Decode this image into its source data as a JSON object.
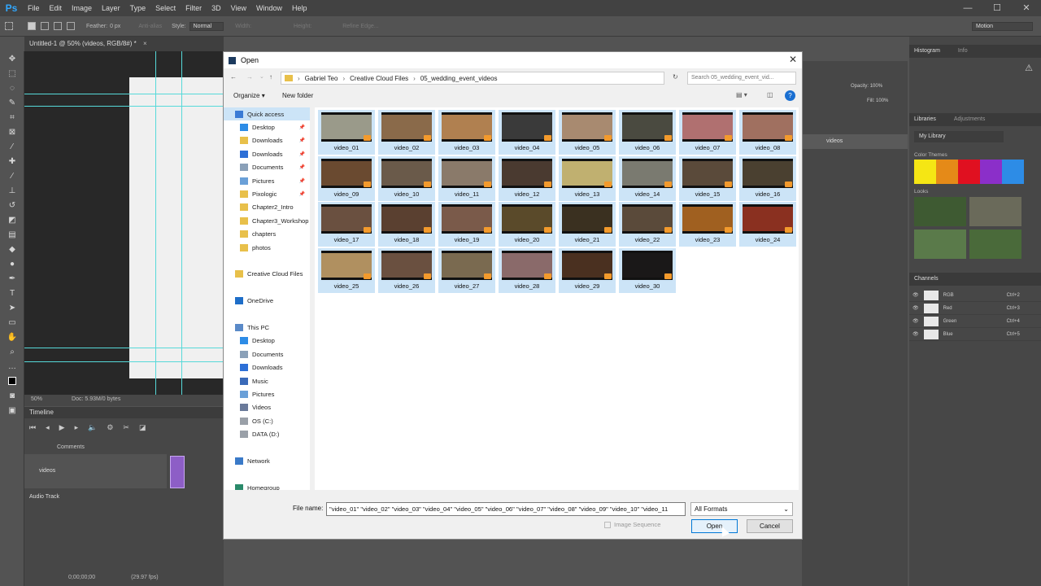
{
  "app": {
    "logo": "Ps",
    "menu": [
      "File",
      "Edit",
      "Image",
      "Layer",
      "Type",
      "Select",
      "Filter",
      "3D",
      "View",
      "Window",
      "Help"
    ]
  },
  "options_bar": {
    "feather_label": "Feather:",
    "feather_value": "0 px",
    "antialias": "Anti-alias",
    "style_label": "Style:",
    "style_value": "Normal",
    "width_label": "Width:",
    "height_label": "Height:",
    "refine": "Refine Edge...",
    "workspace": "Motion"
  },
  "document": {
    "tab_title": "Untitled-1 @ 50% (videos, RGB/8#) *",
    "zoom": "50%",
    "doc_info": "Doc: 5.93M/0 bytes"
  },
  "timeline": {
    "title": "Timeline",
    "comments": "Comments",
    "video_track": "videos",
    "audio_track": "Audio Track",
    "timecode": "0;00;00;00",
    "fps": "(29.97 fps)"
  },
  "right_panels": {
    "histogram_tab": "Histogram",
    "info_tab": "Info",
    "libraries_tab": "Libraries",
    "adjustments_tab": "Adjustments",
    "library_select": "My Library",
    "color_themes": "Color Themes",
    "looks": "Looks",
    "channels_tab": "Channels",
    "opacity_label": "Opacity:",
    "opacity_value": "100%",
    "fill_label": "Fill:",
    "fill_value": "100%",
    "layer_name": "videos",
    "swatches": [
      "#f5e614",
      "#e58a18",
      "#e01020",
      "#8b2fc9",
      "#2d8ce6"
    ],
    "channels": [
      {
        "name": "RGB",
        "shortcut": "Ctrl+2"
      },
      {
        "name": "Red",
        "shortcut": "Ctrl+3"
      },
      {
        "name": "Green",
        "shortcut": "Ctrl+4"
      },
      {
        "name": "Blue",
        "shortcut": "Ctrl+5"
      }
    ]
  },
  "dialog": {
    "title": "Open",
    "breadcrumb": [
      "Gabriel Teo",
      "Creative Cloud Files",
      "05_wedding_event_videos"
    ],
    "search_placeholder": "Search 05_wedding_event_vid...",
    "organize": "Organize",
    "new_folder": "New folder",
    "nav": [
      {
        "label": "Quick access",
        "icon": "star",
        "indent": 0,
        "selected": true
      },
      {
        "label": "Desktop",
        "icon": "desktop",
        "indent": 1,
        "pin": true
      },
      {
        "label": "Downloads",
        "icon": "folder",
        "indent": 1,
        "pin": true
      },
      {
        "label": "Downloads",
        "icon": "download",
        "indent": 1,
        "pin": true
      },
      {
        "label": "Documents",
        "icon": "documents",
        "indent": 1,
        "pin": true
      },
      {
        "label": "Pictures",
        "icon": "pictures",
        "indent": 1,
        "pin": true
      },
      {
        "label": "Pixologic",
        "icon": "folder",
        "indent": 1,
        "pin": true
      },
      {
        "label": "Chapter2_Intro",
        "icon": "folder",
        "indent": 1
      },
      {
        "label": "Chapter3_Workshop",
        "icon": "folder",
        "indent": 1
      },
      {
        "label": "chapters",
        "icon": "folder",
        "indent": 1
      },
      {
        "label": "photos",
        "icon": "folder",
        "indent": 1
      },
      {
        "label": "",
        "icon": "",
        "indent": 0
      },
      {
        "label": "Creative Cloud Files",
        "icon": "folder",
        "indent": 0
      },
      {
        "label": "",
        "icon": "",
        "indent": 0
      },
      {
        "label": "OneDrive",
        "icon": "cloud",
        "indent": 0
      },
      {
        "label": "",
        "icon": "",
        "indent": 0
      },
      {
        "label": "This PC",
        "icon": "pc",
        "indent": 0
      },
      {
        "label": "Desktop",
        "icon": "desktop",
        "indent": 1
      },
      {
        "label": "Documents",
        "icon": "documents",
        "indent": 1
      },
      {
        "label": "Downloads",
        "icon": "download",
        "indent": 1
      },
      {
        "label": "Music",
        "icon": "music",
        "indent": 1
      },
      {
        "label": "Pictures",
        "icon": "pictures",
        "indent": 1
      },
      {
        "label": "Videos",
        "icon": "videos",
        "indent": 1
      },
      {
        "label": "OS (C:)",
        "icon": "drive",
        "indent": 1
      },
      {
        "label": "DATA (D:)",
        "icon": "drive",
        "indent": 1
      },
      {
        "label": "",
        "icon": "",
        "indent": 0
      },
      {
        "label": "Network",
        "icon": "network",
        "indent": 0
      },
      {
        "label": "",
        "icon": "",
        "indent": 0
      },
      {
        "label": "Homegroup",
        "icon": "homegroup",
        "indent": 0
      }
    ],
    "files": [
      {
        "name": "video_01",
        "tone": "#9a9a8a"
      },
      {
        "name": "video_02",
        "tone": "#8a6a4a"
      },
      {
        "name": "video_03",
        "tone": "#b08050"
      },
      {
        "name": "video_04",
        "tone": "#3a3a3a"
      },
      {
        "name": "video_05",
        "tone": "#a88a70"
      },
      {
        "name": "video_06",
        "tone": "#4a4a40"
      },
      {
        "name": "video_07",
        "tone": "#b07070"
      },
      {
        "name": "video_08",
        "tone": "#a07060"
      },
      {
        "name": "video_09",
        "tone": "#6a4a30"
      },
      {
        "name": "video_10",
        "tone": "#6a5a4a"
      },
      {
        "name": "video_11",
        "tone": "#8a7a6a"
      },
      {
        "name": "video_12",
        "tone": "#4a3a30"
      },
      {
        "name": "video_13",
        "tone": "#c0b070"
      },
      {
        "name": "video_14",
        "tone": "#7a7a70"
      },
      {
        "name": "video_15",
        "tone": "#5a4a3a"
      },
      {
        "name": "video_16",
        "tone": "#4a4030"
      },
      {
        "name": "video_17",
        "tone": "#6a5040"
      },
      {
        "name": "video_18",
        "tone": "#5a4030"
      },
      {
        "name": "video_19",
        "tone": "#7a5a4a"
      },
      {
        "name": "video_20",
        "tone": "#5a4a2a"
      },
      {
        "name": "video_21",
        "tone": "#3a3020"
      },
      {
        "name": "video_22",
        "tone": "#5a4a3a"
      },
      {
        "name": "video_23",
        "tone": "#a06020"
      },
      {
        "name": "video_24",
        "tone": "#8a3020"
      },
      {
        "name": "video_25",
        "tone": "#b09060"
      },
      {
        "name": "video_26",
        "tone": "#6a5040"
      },
      {
        "name": "video_27",
        "tone": "#7a6a50"
      },
      {
        "name": "video_28",
        "tone": "#8a6a6a"
      },
      {
        "name": "video_29",
        "tone": "#4a3020"
      },
      {
        "name": "video_30",
        "tone": "#1a1818"
      }
    ],
    "file_name_label": "File name:",
    "file_name_value": "\"video_01\" \"video_02\" \"video_03\" \"video_04\" \"video_05\" \"video_06\" \"video_07\" \"video_08\" \"video_09\" \"video_10\" \"video_11",
    "format": "All Formats",
    "image_sequence": "Image Sequence",
    "open_btn": "Open",
    "cancel_btn": "Cancel"
  }
}
